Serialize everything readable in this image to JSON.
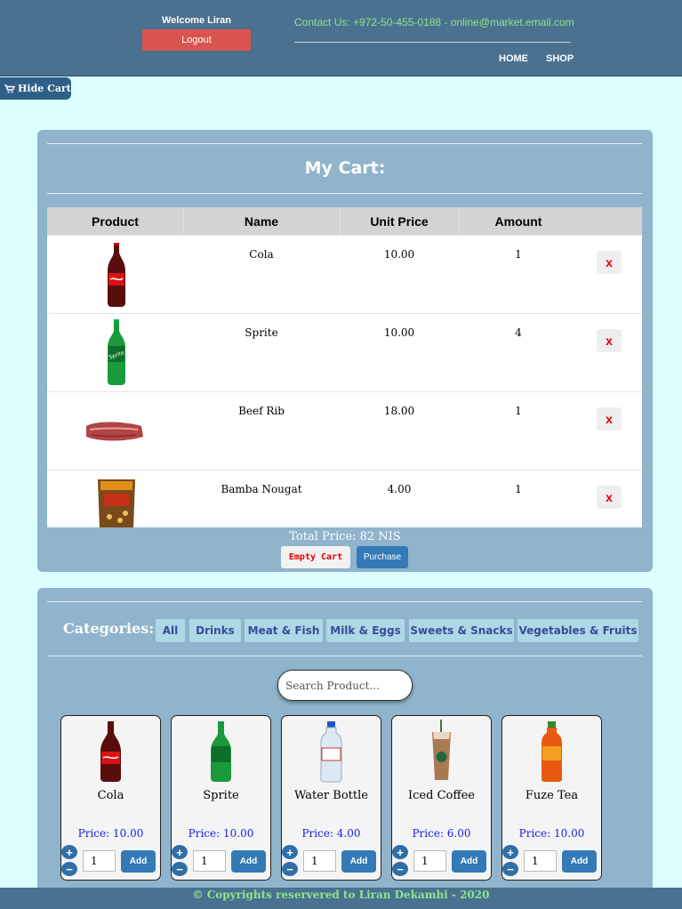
{
  "header": {
    "welcome": "Welcome Liran",
    "logout_label": "Logout",
    "contact": "Contact Us: +972-50-455-0188 - online@market.email.com",
    "nav": {
      "home": "HOME",
      "shop": "SHOP"
    }
  },
  "toggle_cart": {
    "label": "Hide Cart",
    "icon": "cart-icon"
  },
  "cart": {
    "title": "My Cart:",
    "columns": [
      "Product",
      "Name",
      "Unit Price",
      "Amount"
    ],
    "items": [
      {
        "name": "Cola",
        "unit_price": "10.00",
        "amount": "1",
        "image": "cola-bottle",
        "remove": "x"
      },
      {
        "name": "Sprite",
        "unit_price": "10.00",
        "amount": "4",
        "image": "sprite-bottle",
        "remove": "x"
      },
      {
        "name": "Beef Rib",
        "unit_price": "18.00",
        "amount": "1",
        "image": "beef-rib",
        "remove": "x"
      },
      {
        "name": "Bamba Nougat",
        "unit_price": "4.00",
        "amount": "1",
        "image": "bamba-bag",
        "remove": "x"
      }
    ],
    "total": "Total Price: 82 NIS",
    "empty_label": "Empty Cart",
    "purchase_label": "Purchase"
  },
  "shop": {
    "categories_label": "Categories:",
    "categories": [
      "All",
      "Drinks",
      "Meat & Fish",
      "Milk & Eggs",
      "Sweets & Snacks",
      "Vegetables & Fruits"
    ],
    "search_placeholder": "Search Product...",
    "products": [
      {
        "name": "Cola",
        "price": "Price: 10.00",
        "qty": "1",
        "add": "Add",
        "image": "cola-bottle"
      },
      {
        "name": "Sprite",
        "price": "Price: 10.00",
        "qty": "1",
        "add": "Add",
        "image": "sprite-bottle"
      },
      {
        "name": "Water Bottle",
        "price": "Price: 4.00",
        "qty": "1",
        "add": "Add",
        "image": "water-bottle"
      },
      {
        "name": "Iced Coffee",
        "price": "Price: 6.00",
        "qty": "1",
        "add": "Add",
        "image": "iced-coffee-cup"
      },
      {
        "name": "Fuze Tea",
        "price": "Price: 10.00",
        "qty": "1",
        "add": "Add",
        "image": "fuze-tea-bottle"
      }
    ],
    "plus": "+",
    "minus": "−"
  },
  "footer": {
    "text": "© Copyrights reservered to Liran Dekamhi - 2020"
  },
  "colors": {
    "header_bg": "#4a718f",
    "page_bg": "#dcffff",
    "panel_bg": "#8fb4cb",
    "accent_blue": "#337ab7",
    "danger": "#d9534f",
    "contact_green": "#8ee58e"
  }
}
